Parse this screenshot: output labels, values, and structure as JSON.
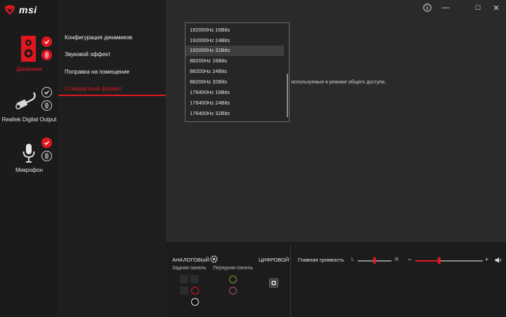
{
  "app": {
    "logo_text": "msi"
  },
  "window_controls": {
    "info": "ⓘ",
    "minimize": "—",
    "maximize": "☐",
    "close": "✕"
  },
  "devices": [
    {
      "label": "Динамики",
      "active": true,
      "icon": "speaker-icon",
      "badge": "check-badge",
      "sub_badge": "info-badge"
    },
    {
      "label": "Realtek Digital Output",
      "active": false,
      "icon": "optical-cable-icon",
      "badge": "check-badge",
      "sub_badge": "info-badge"
    },
    {
      "label": "Микрофон",
      "active": false,
      "icon": "microphone-icon",
      "badge": "check-badge",
      "sub_badge": "info-badge"
    }
  ],
  "nav": {
    "items": [
      {
        "label": "Конфигурация динамиков"
      },
      {
        "label": "Звуковой эффект"
      },
      {
        "label": "Поправка на помещение"
      },
      {
        "label": "Стандартный формат"
      }
    ],
    "active_index": 3
  },
  "main": {
    "info_text": "сть, используемые в режиме общего доступа."
  },
  "format_dropdown": {
    "options": [
      "192000Hz 16Bits",
      "192000Hz 24Bits",
      "192000Hz 32Bits",
      "88200Hz 16Bits",
      "88200Hz 24Bits",
      "88200Hz 32Bits",
      "176400Hz 16Bits",
      "176400Hz 24Bits",
      "176400Hz 32Bits"
    ],
    "highlighted_index": 2
  },
  "bottom": {
    "analog_label": "АНАЛОГОВЫЙ",
    "digital_label": "ЦИФРОВОЙ",
    "rear_panel_label": "Задняя панель",
    "front_panel_label": "Передняя панель",
    "master_volume_label": "Главная громкость",
    "balance_left": "L",
    "balance_right": "R",
    "volume_minus": "−",
    "volume_plus": "+",
    "balance_value": 0.5,
    "volume_value": 0.35
  },
  "colors": {
    "accent": "#e0171f",
    "background": "#262626",
    "front_jack_green": "#8a9a2a",
    "front_jack_pink": "#b2506e"
  }
}
